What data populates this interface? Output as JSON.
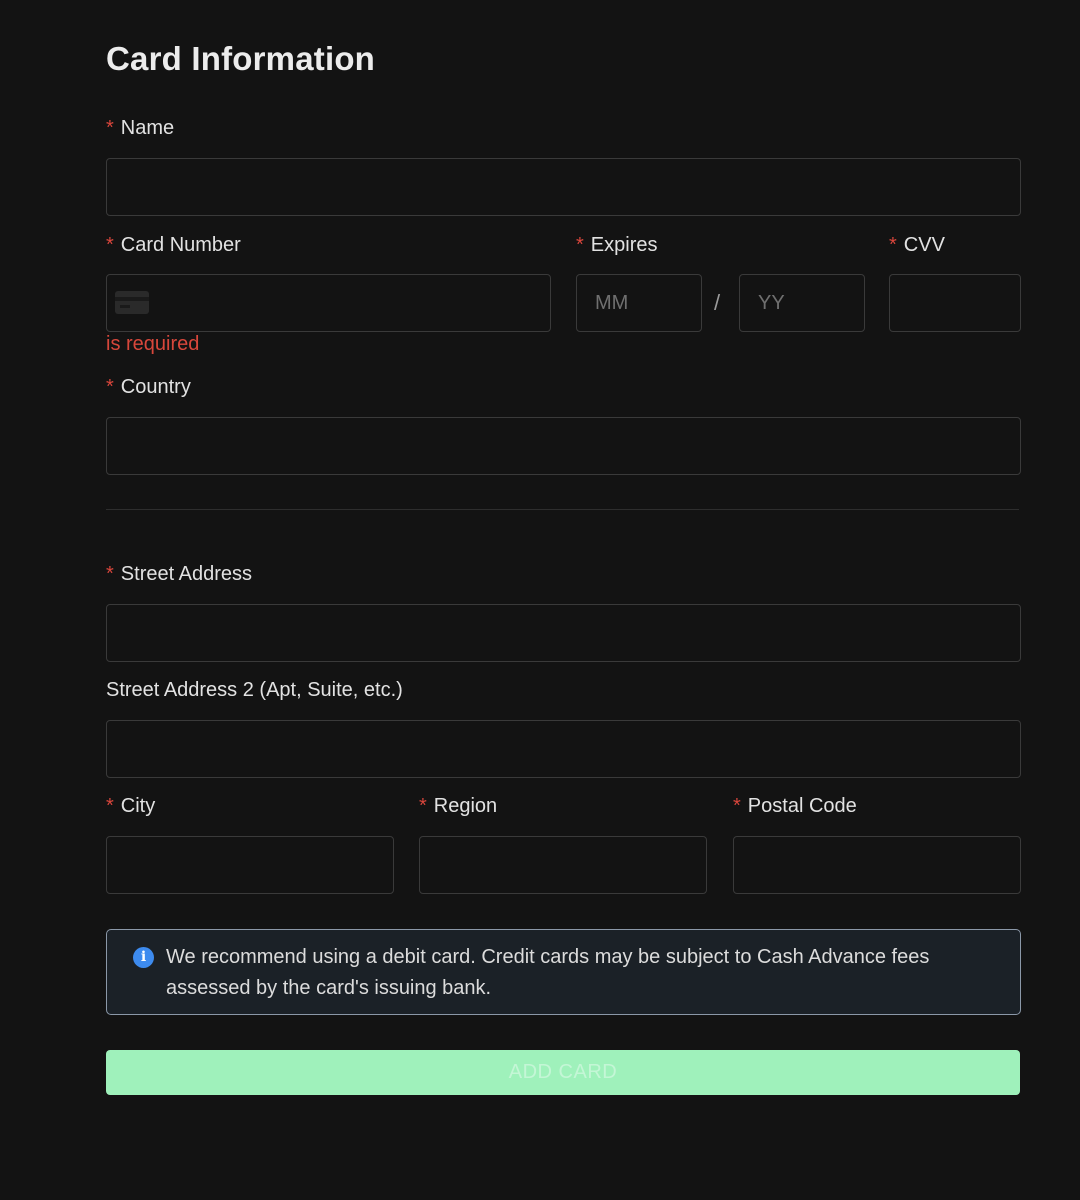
{
  "form": {
    "title": "Card Information",
    "required_marker": "*",
    "name": {
      "label": "Name",
      "value": ""
    },
    "card_number": {
      "label": "Card Number",
      "value": "",
      "error": "is required"
    },
    "expires": {
      "label": "Expires",
      "month_placeholder": "MM",
      "year_placeholder": "YY",
      "separator": "/"
    },
    "cvv": {
      "label": "CVV",
      "value": ""
    },
    "country": {
      "label": "Country",
      "value": ""
    },
    "street_address": {
      "label": "Street Address",
      "value": ""
    },
    "street_address_2": {
      "label": "Street Address 2 (Apt, Suite, etc.)",
      "value": ""
    },
    "city": {
      "label": "City",
      "value": ""
    },
    "region": {
      "label": "Region",
      "value": ""
    },
    "postal_code": {
      "label": "Postal Code",
      "value": ""
    }
  },
  "notice": {
    "icon": "info-icon",
    "text": "We recommend using a debit card. Credit cards may be subject to Cash Advance fees assessed by the card's issuing bank."
  },
  "submit": {
    "label": "ADD CARD",
    "enabled": false
  },
  "colors": {
    "background": "#131313",
    "required": "#d9463c",
    "error": "#d8473b",
    "info_accent": "#3d8bef",
    "button": "#9ff1bb"
  }
}
